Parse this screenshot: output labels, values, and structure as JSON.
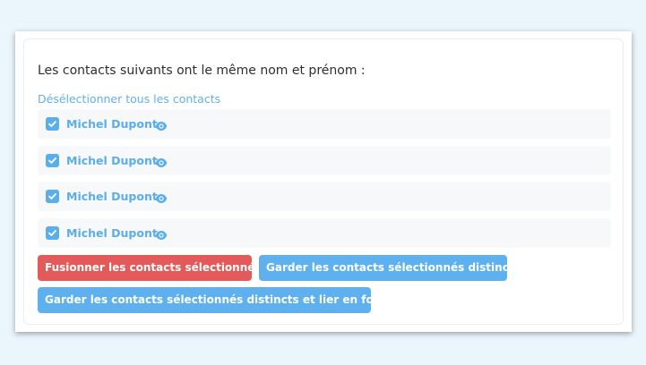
{
  "heading": "Les contacts suivants ont le même nom et prénom :",
  "deselect_label": "Désélectionner tous les contacts",
  "contacts": [
    {
      "name": "Michel Dupont",
      "checked": true,
      "icon": "eye-icon"
    },
    {
      "name": "Michel Dupont",
      "checked": true,
      "icon": "eye-icon"
    },
    {
      "name": "Michel Dupont",
      "checked": true,
      "icon": "eye-icon"
    },
    {
      "name": "Michel Dupont",
      "checked": true,
      "icon": "eye-icon"
    }
  ],
  "buttons": {
    "merge": "Fusionner les contacts sélectionnés",
    "keep_distinct": "Garder les contacts sélectionnés distincts",
    "keep_distinct_link_household": "Garder les contacts sélectionnés distincts et lier en foyer"
  },
  "colors": {
    "background": "#eaf5fc",
    "accent": "#5fb0ee",
    "danger": "#e25a5a",
    "row_background": "#f6f8f9"
  }
}
